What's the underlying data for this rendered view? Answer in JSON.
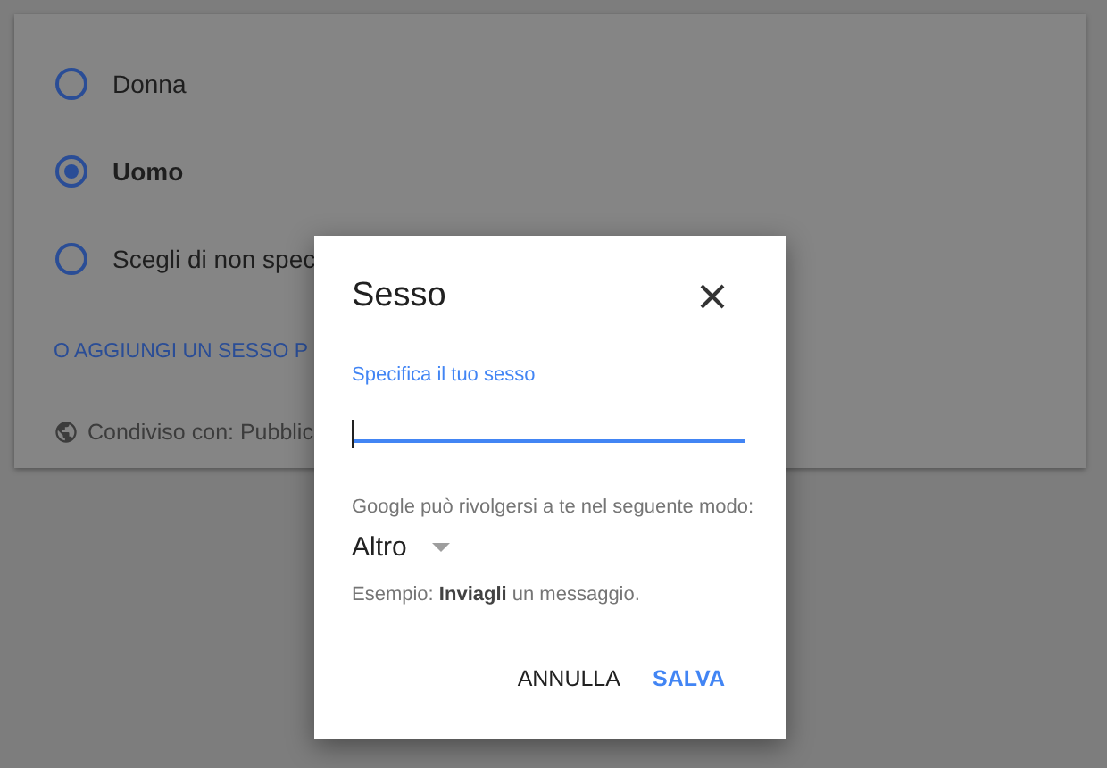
{
  "options": [
    {
      "label": "Donna",
      "selected": false
    },
    {
      "label": "Uomo",
      "selected": true
    },
    {
      "label": "Scegli di non spec",
      "selected": false
    }
  ],
  "add_link": "O AGGIUNGI UN SESSO P",
  "shared": "Condiviso con: Pubblic",
  "dialog": {
    "title": "Sesso",
    "field_label": "Specifica il tuo sesso",
    "hint": "Google può rivolgersi a te nel seguente modo:",
    "pronoun": "Altro",
    "example": "Esempio: **Inviagli** un messaggio.",
    "buttons": [
      {
        "label": "ANNULLA",
        "kind": "cancel"
      },
      {
        "label": "SALVA",
        "kind": "save"
      }
    ]
  }
}
